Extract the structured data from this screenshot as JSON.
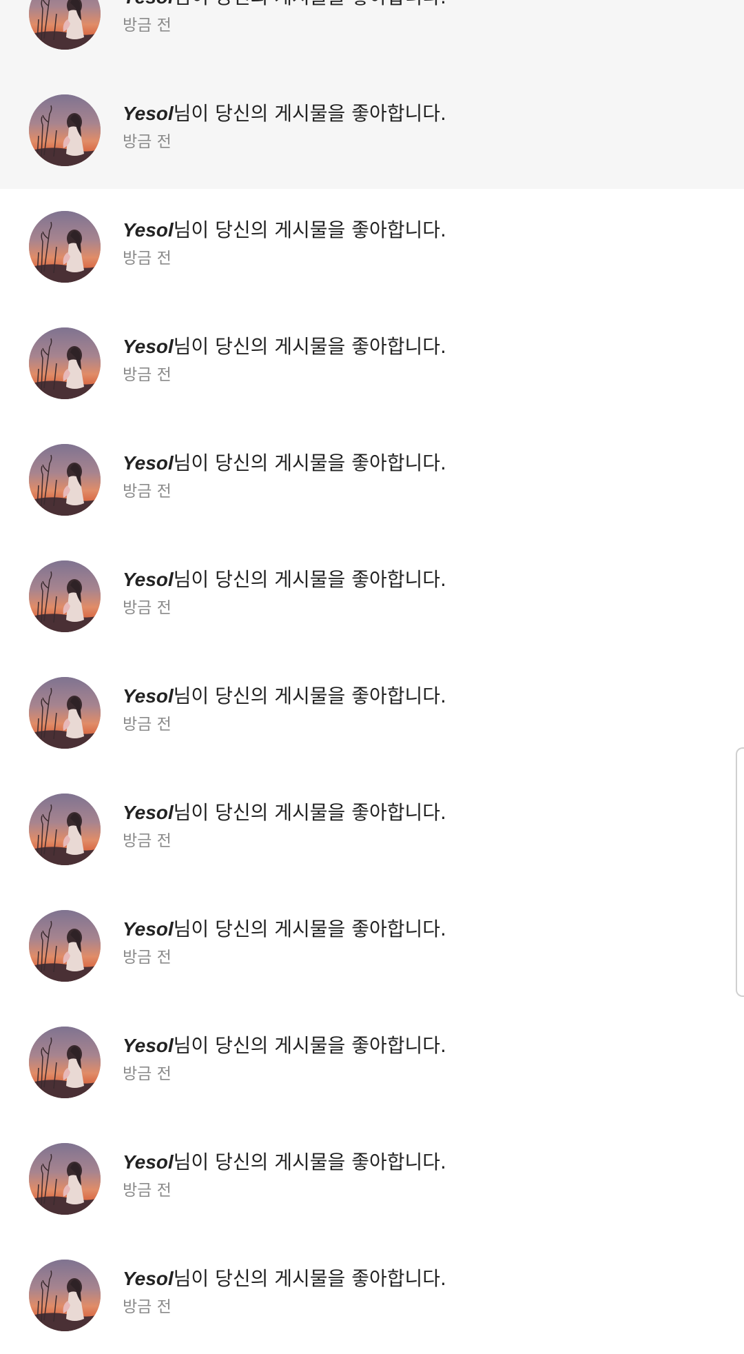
{
  "notifications": [
    {
      "username": "Yesol",
      "message_suffix": "님이 당신의 게시물을 좋아합니다.",
      "timestamp": "방금 전",
      "unread": true
    },
    {
      "username": "Yesol",
      "message_suffix": "님이 당신의 게시물을 좋아합니다.",
      "timestamp": "방금 전",
      "unread": true
    },
    {
      "username": "Yesol",
      "message_suffix": "님이 당신의 게시물을 좋아합니다.",
      "timestamp": "방금 전",
      "unread": false
    },
    {
      "username": "Yesol",
      "message_suffix": "님이 당신의 게시물을 좋아합니다.",
      "timestamp": "방금 전",
      "unread": false
    },
    {
      "username": "Yesol",
      "message_suffix": "님이 당신의 게시물을 좋아합니다.",
      "timestamp": "방금 전",
      "unread": false
    },
    {
      "username": "Yesol",
      "message_suffix": "님이 당신의 게시물을 좋아합니다.",
      "timestamp": "방금 전",
      "unread": false
    },
    {
      "username": "Yesol",
      "message_suffix": "님이 당신의 게시물을 좋아합니다.",
      "timestamp": "방금 전",
      "unread": false
    },
    {
      "username": "Yesol",
      "message_suffix": "님이 당신의 게시물을 좋아합니다.",
      "timestamp": "방금 전",
      "unread": false
    },
    {
      "username": "Yesol",
      "message_suffix": "님이 당신의 게시물을 좋아합니다.",
      "timestamp": "방금 전",
      "unread": false
    },
    {
      "username": "Yesol",
      "message_suffix": "님이 당신의 게시물을 좋아합니다.",
      "timestamp": "방금 전",
      "unread": false
    },
    {
      "username": "Yesol",
      "message_suffix": "님이 당신의 게시물을 좋아합니다.",
      "timestamp": "방금 전",
      "unread": false
    },
    {
      "username": "Yesol",
      "message_suffix": "님이 당신의 게시물을 좋아합니다.",
      "timestamp": "방금 전",
      "unread": false
    }
  ],
  "colors": {
    "unread_background": "#f6f6f6",
    "accent": "#e8532c",
    "timestamp_text": "#8a8a8a",
    "message_text": "#222222"
  },
  "icons": {
    "avatar": "profile-photo-sunset-girl"
  }
}
